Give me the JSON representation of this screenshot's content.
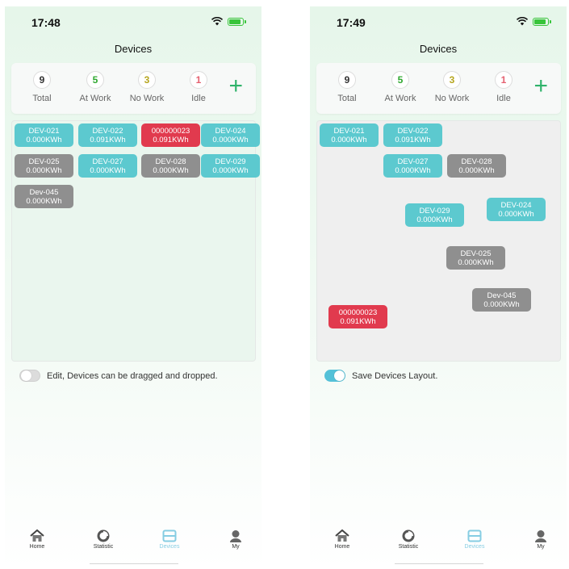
{
  "left": {
    "time": "17:48",
    "title": "Devices",
    "stats": [
      {
        "value": "9",
        "label": "Total",
        "color": "#333333"
      },
      {
        "value": "5",
        "label": "At Work",
        "color": "#2fa82f"
      },
      {
        "value": "3",
        "label": "No Work",
        "color": "#b6a61e"
      },
      {
        "value": "1",
        "label": "Idle",
        "color": "#e56070"
      }
    ],
    "devices": [
      {
        "name": "DEV-021",
        "energy": "0.000KWh",
        "status": "work"
      },
      {
        "name": "DEV-022",
        "energy": "0.091KWh",
        "status": "work"
      },
      {
        "name": "000000023",
        "energy": "0.091KWh",
        "status": "idle"
      },
      {
        "name": "DEV-024",
        "energy": "0.000KWh",
        "status": "work"
      },
      {
        "name": "DEV-025",
        "energy": "0.000KWh",
        "status": "nowork"
      },
      {
        "name": "DEV-027",
        "energy": "0.000KWh",
        "status": "work"
      },
      {
        "name": "DEV-028",
        "energy": "0.000KWh",
        "status": "nowork"
      },
      {
        "name": "DEV-029",
        "energy": "0.000KWh",
        "status": "work"
      },
      {
        "name": "Dev-045",
        "energy": "0.000KWh",
        "status": "nowork"
      }
    ],
    "toggle_label": "Edit, Devices can be dragged and dropped.",
    "toggle_on": false
  },
  "right": {
    "time": "17:49",
    "title": "Devices",
    "stats": [
      {
        "value": "9",
        "label": "Total",
        "color": "#333333"
      },
      {
        "value": "5",
        "label": "At Work",
        "color": "#2fa82f"
      },
      {
        "value": "3",
        "label": "No Work",
        "color": "#b6a61e"
      },
      {
        "value": "1",
        "label": "Idle",
        "color": "#e56070"
      }
    ],
    "devices": [
      {
        "name": "DEV-021",
        "energy": "0.000KWh",
        "status": "work"
      },
      {
        "name": "DEV-022",
        "energy": "0.091KWh",
        "status": "work"
      },
      {
        "name": "DEV-027",
        "energy": "0.000KWh",
        "status": "work"
      },
      {
        "name": "DEV-028",
        "energy": "0.000KWh",
        "status": "nowork"
      },
      {
        "name": "DEV-029",
        "energy": "0.000KWh",
        "status": "work"
      },
      {
        "name": "DEV-024",
        "energy": "0.000KWh",
        "status": "work"
      },
      {
        "name": "DEV-025",
        "energy": "0.000KWh",
        "status": "nowork"
      },
      {
        "name": "Dev-045",
        "energy": "0.000KWh",
        "status": "nowork"
      },
      {
        "name": "000000023",
        "energy": "0.091KWh",
        "status": "idle"
      }
    ],
    "toggle_label": "Save Devices Layout.",
    "toggle_on": true
  },
  "tabbar": {
    "items": [
      {
        "label": "Home",
        "icon": "home-icon"
      },
      {
        "label": "Statistic",
        "icon": "statistic-icon"
      },
      {
        "label": "Devices",
        "icon": "devices-icon",
        "active": true
      },
      {
        "label": "My",
        "icon": "user-icon"
      }
    ],
    "active_color": "#86cde3"
  },
  "colors": {
    "work": "#5cc9cf",
    "nowork": "#8f8f8f",
    "idle": "#e13a4e",
    "plus": "#2fb36a"
  }
}
